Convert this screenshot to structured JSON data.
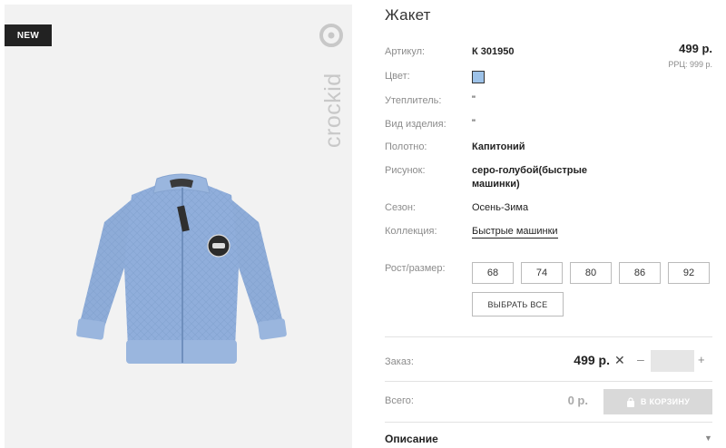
{
  "product": {
    "badge": "NEW",
    "brand": "crockid",
    "title": "Жакет",
    "price": "499 р.",
    "rrp": "РРЦ: 999 р.",
    "color_hex": "#9dc2e8"
  },
  "attributes": [
    {
      "label": "Артикул:",
      "value": "К 301950"
    },
    {
      "label": "Цвет:",
      "value": ""
    },
    {
      "label": "Утеплитель:",
      "value": "\""
    },
    {
      "label": "Вид изделия:",
      "value": "\""
    },
    {
      "label": "Полотно:",
      "value": "Капитоний"
    },
    {
      "label": "Рисунок:",
      "value_line1": "серо-голубой(быстрые",
      "value_line2": "машинки)"
    },
    {
      "label": "Сезон:",
      "value": "Осень-Зима"
    },
    {
      "label": "Коллекция:",
      "value": "Быстрые машинки"
    }
  ],
  "sizes": {
    "label": "Рост/размер:",
    "options": [
      "68",
      "74",
      "80",
      "86",
      "92"
    ],
    "select_all": "ВЫБРАТЬ ВСЕ"
  },
  "order": {
    "label": "Заказ:",
    "price": "499 р.",
    "times": "✕",
    "minus": "–",
    "plus": "+",
    "quantity": ""
  },
  "total": {
    "label": "Всего:",
    "value": "0 р.",
    "cart_button": "В КОРЗИНУ"
  },
  "description": {
    "title": "Описание",
    "arrow": "▼"
  }
}
